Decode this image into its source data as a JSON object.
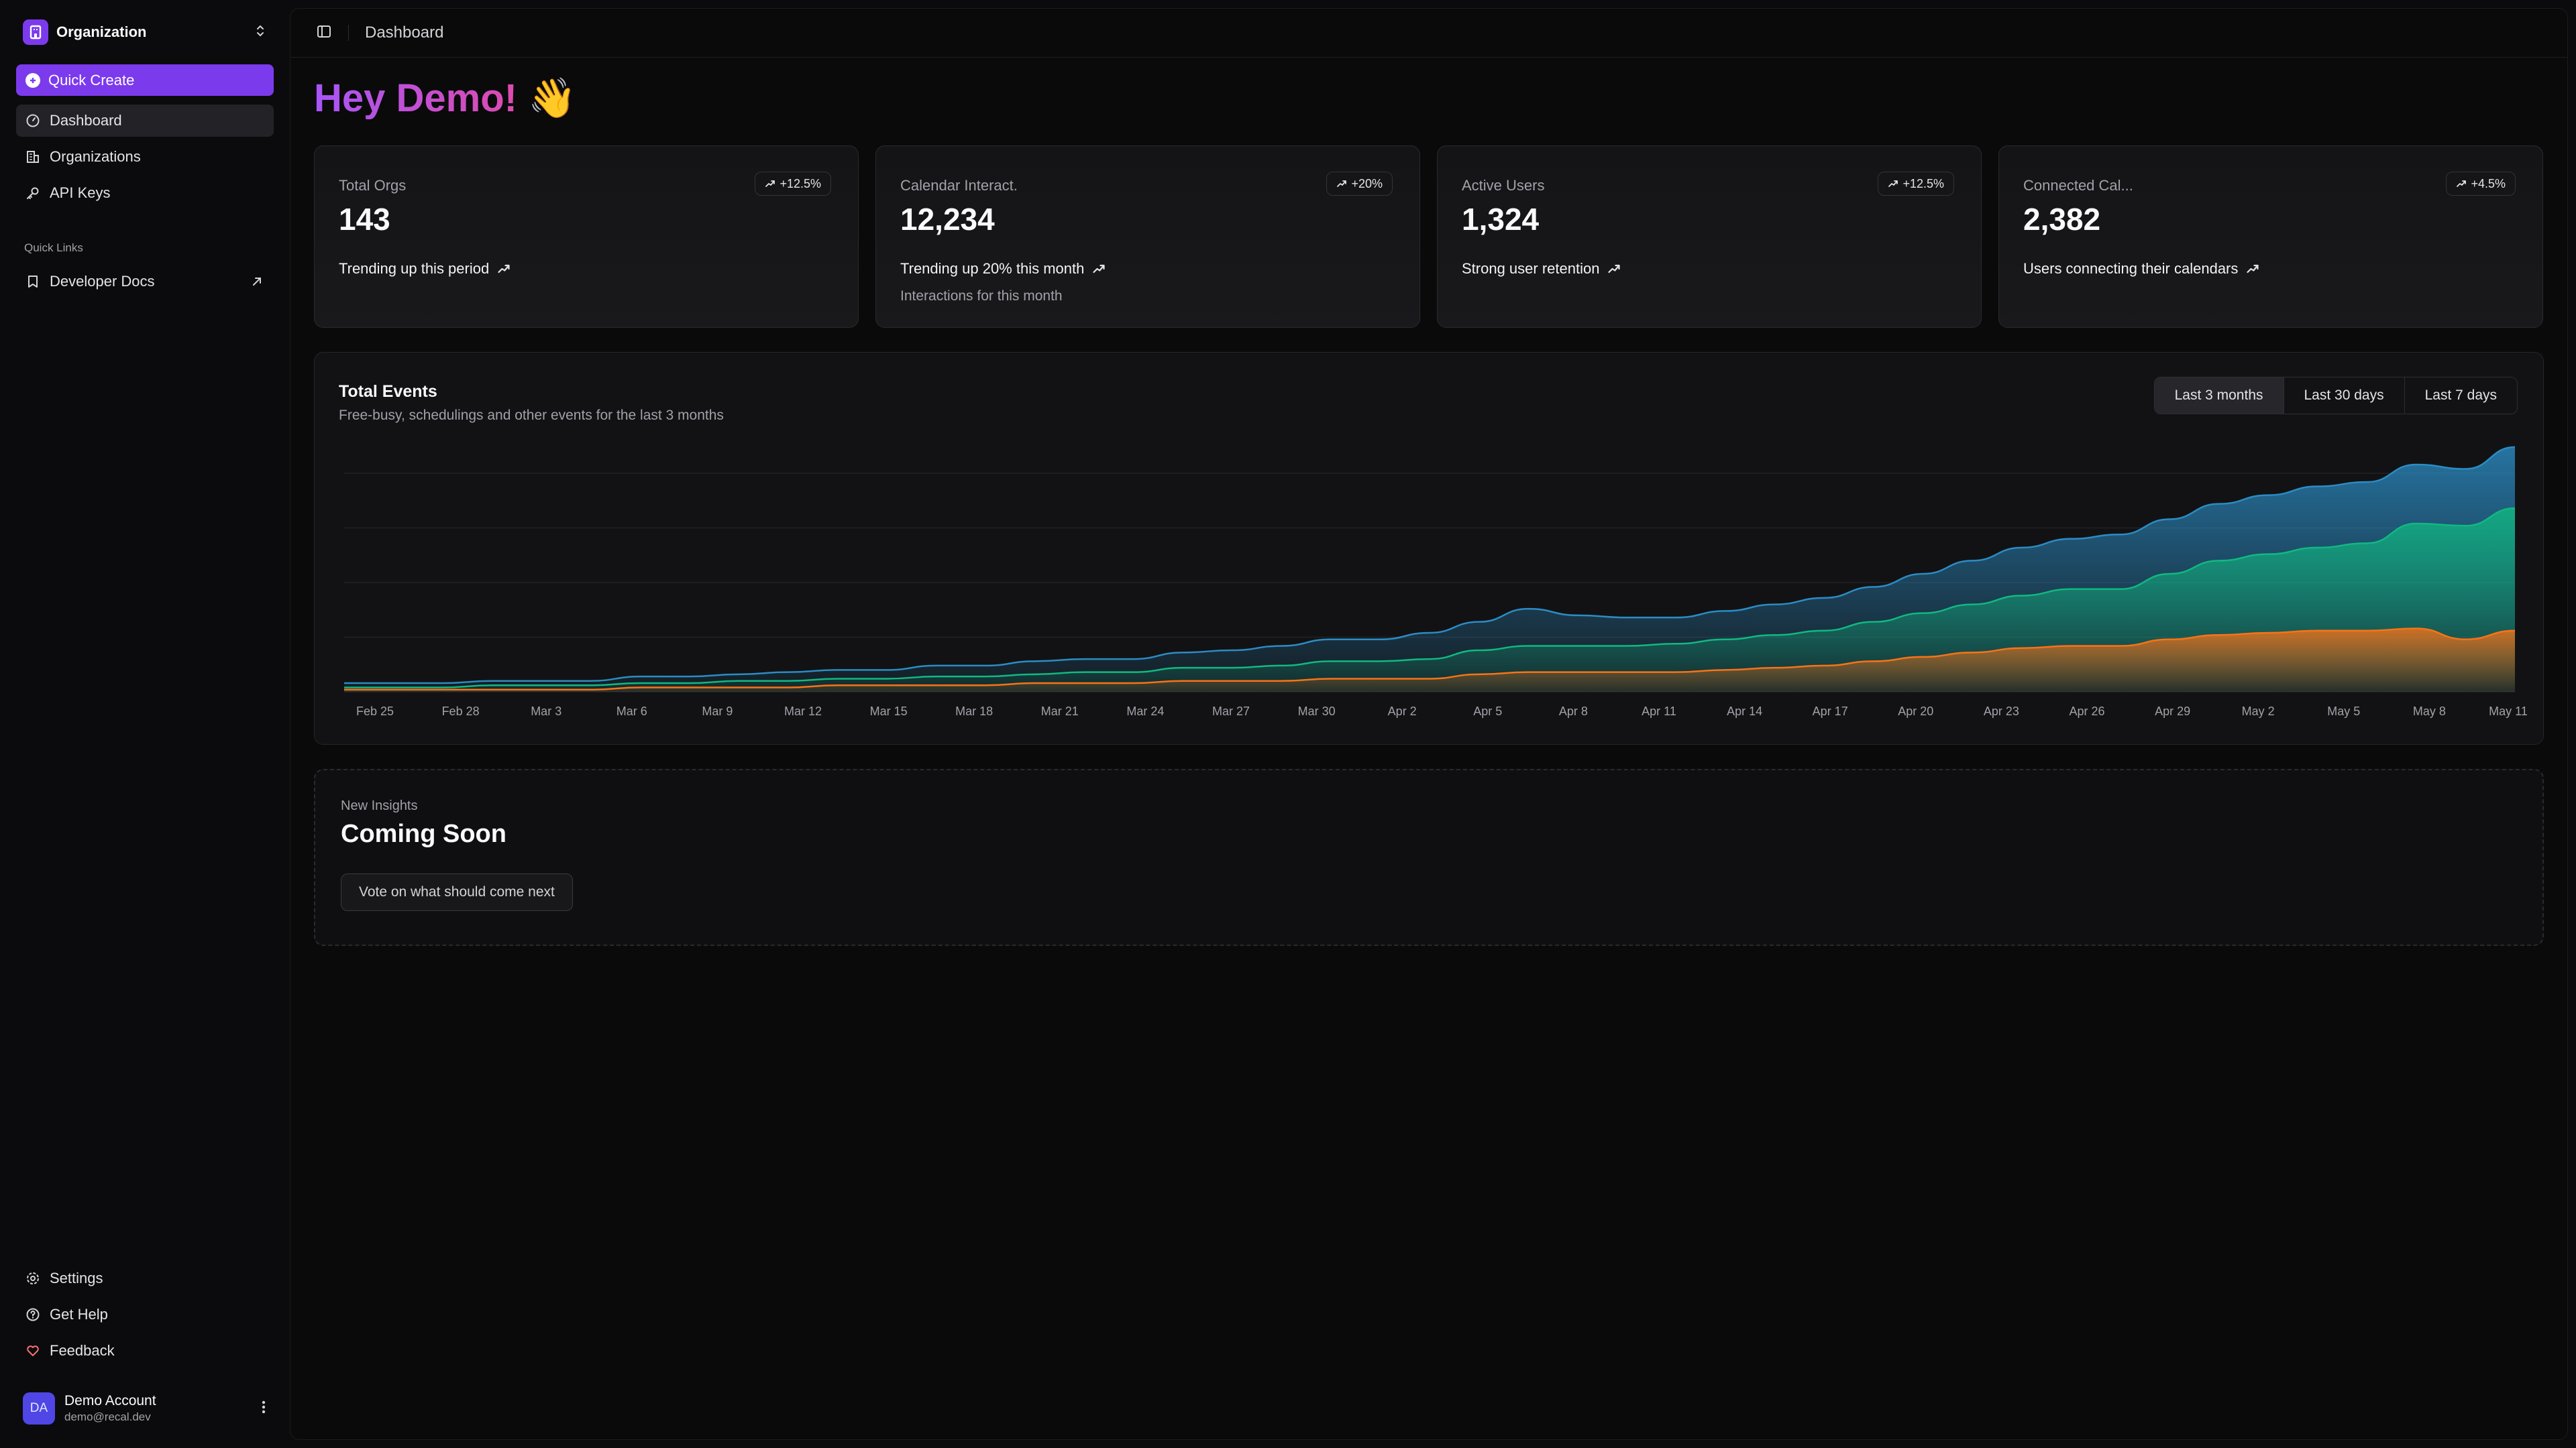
{
  "sidebar": {
    "org_name": "Organization",
    "quick_create": "Quick Create",
    "nav": [
      {
        "label": "Dashboard",
        "icon": "gauge-icon",
        "active": true
      },
      {
        "label": "Organizations",
        "icon": "building-icon"
      },
      {
        "label": "API Keys",
        "icon": "key-icon"
      }
    ],
    "quick_links_title": "Quick Links",
    "quick_links": [
      {
        "label": "Developer Docs",
        "icon": "bookmark-icon"
      }
    ],
    "footer_nav": [
      {
        "label": "Settings",
        "icon": "gear-icon"
      },
      {
        "label": "Get Help",
        "icon": "help-circle-icon"
      },
      {
        "label": "Feedback",
        "icon": "heart-icon"
      }
    ],
    "user": {
      "initials": "DA",
      "name": "Demo Account",
      "email": "demo@recal.dev"
    }
  },
  "topbar": {
    "title": "Dashboard"
  },
  "greeting": {
    "text": "Hey Demo!",
    "emoji": "👋"
  },
  "stats": [
    {
      "label": "Total Orgs",
      "value": "143",
      "badge": "+12.5%",
      "trend": "Trending up this period",
      "sub": ""
    },
    {
      "label": "Calendar Interact.",
      "value": "12,234",
      "badge": "+20%",
      "trend": "Trending up 20% this month",
      "sub": "Interactions for this month"
    },
    {
      "label": "Active Users",
      "value": "1,324",
      "badge": "+12.5%",
      "trend": "Strong user retention",
      "sub": ""
    },
    {
      "label": "Connected Cal...",
      "value": "2,382",
      "badge": "+4.5%",
      "trend": "Users connecting their calendars",
      "sub": ""
    }
  ],
  "events": {
    "title": "Total Events",
    "subtitle": "Free-busy, schedulings and other events for the last 3 months",
    "ranges": [
      "Last 3 months",
      "Last 30 days",
      "Last 7 days"
    ],
    "active_range": "Last 3 months"
  },
  "insights": {
    "label": "New Insights",
    "title": "Coming Soon",
    "button": "Vote on what should come next"
  },
  "colors": {
    "accent": "#7c3aed",
    "series_total": "#2b8cc4",
    "series_mid": "#10b981",
    "series_low": "#f97316"
  },
  "chart_data": {
    "type": "area",
    "title": "Total Events",
    "subtitle": "Free-busy, schedulings and other events for the last 3 months",
    "xlabel": "",
    "ylabel": "",
    "grid": true,
    "stacked": true,
    "x_ticks": [
      "Feb 25",
      "Feb 28",
      "Mar 3",
      "Mar 6",
      "Mar 9",
      "Mar 12",
      "Mar 15",
      "Mar 18",
      "Mar 21",
      "Mar 24",
      "Mar 27",
      "Mar 30",
      "Apr 2",
      "Apr 5",
      "Apr 8",
      "Apr 11",
      "Apr 14",
      "Apr 17",
      "Apr 20",
      "Apr 23",
      "Apr 26",
      "Apr 29",
      "May 2",
      "May 5",
      "May 8",
      "May 11"
    ],
    "ylim": [
      0,
      100
    ],
    "series": [
      {
        "values": [
          2,
          2,
          2,
          2,
          2,
          2,
          3,
          3,
          3,
          4,
          4,
          4,
          5,
          5,
          6,
          6,
          6,
          7,
          8,
          9,
          10,
          10,
          12,
          13,
          17,
          14,
          13,
          12,
          13,
          14,
          15,
          16,
          18,
          20,
          22,
          23,
          25,
          25,
          26,
          27,
          28,
          28,
          27,
          26,
          28
        ]
      },
      {
        "values": [
          1,
          1,
          1,
          2,
          2,
          2,
          2,
          2,
          3,
          3,
          3,
          3,
          4,
          4,
          4,
          5,
          5,
          6,
          6,
          7,
          8,
          8,
          9,
          11,
          12,
          12,
          12,
          13,
          14,
          15,
          16,
          18,
          20,
          22,
          24,
          26,
          26,
          30,
          34,
          36,
          38,
          40,
          48,
          52,
          56
        ]
      },
      {
        "values": [
          1,
          1,
          1,
          1,
          1,
          1,
          2,
          2,
          2,
          2,
          3,
          3,
          3,
          3,
          4,
          4,
          4,
          5,
          5,
          5,
          6,
          6,
          6,
          8,
          9,
          9,
          9,
          9,
          10,
          11,
          12,
          14,
          16,
          18,
          20,
          21,
          21,
          24,
          26,
          27,
          28,
          28,
          29,
          24,
          28
        ]
      }
    ]
  }
}
